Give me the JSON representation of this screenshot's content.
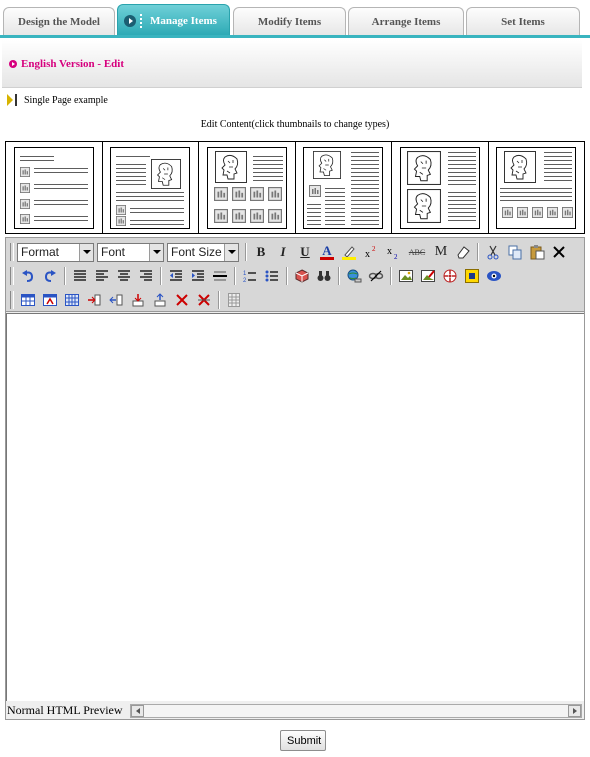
{
  "tabs": [
    {
      "label": "Design the Model",
      "active": false
    },
    {
      "label": "Manage Items",
      "active": true
    },
    {
      "label": "Modify Items",
      "active": false
    },
    {
      "label": "Arrange Items",
      "active": false
    },
    {
      "label": "Set Items",
      "active": false
    }
  ],
  "section": {
    "title": "English Version - Edit"
  },
  "page_example": "Single Page example",
  "edit_caption": "Edit Content(click thumbnails to change types)",
  "thumbnails": [
    {
      "icon": "layout-list-with-image-icons"
    },
    {
      "icon": "layout-text-with-right-image"
    },
    {
      "icon": "layout-image-over-grid"
    },
    {
      "icon": "layout-image-left-two-columns"
    },
    {
      "icon": "layout-two-images-with-text"
    },
    {
      "icon": "layout-image-top-icon-row"
    }
  ],
  "editor": {
    "format_label": "Format",
    "font_label": "Font",
    "font_size_label": "Font Size",
    "bold_label": "B",
    "italic_label": "I",
    "underline_label": "U",
    "font_color_label": "A",
    "font_color": "#cc0000",
    "highlight_color": "#ffee00",
    "strike_label": "ABC",
    "remove_format_label": "M",
    "modes": "Normal HTML Preview"
  },
  "submit_label": "Submit"
}
